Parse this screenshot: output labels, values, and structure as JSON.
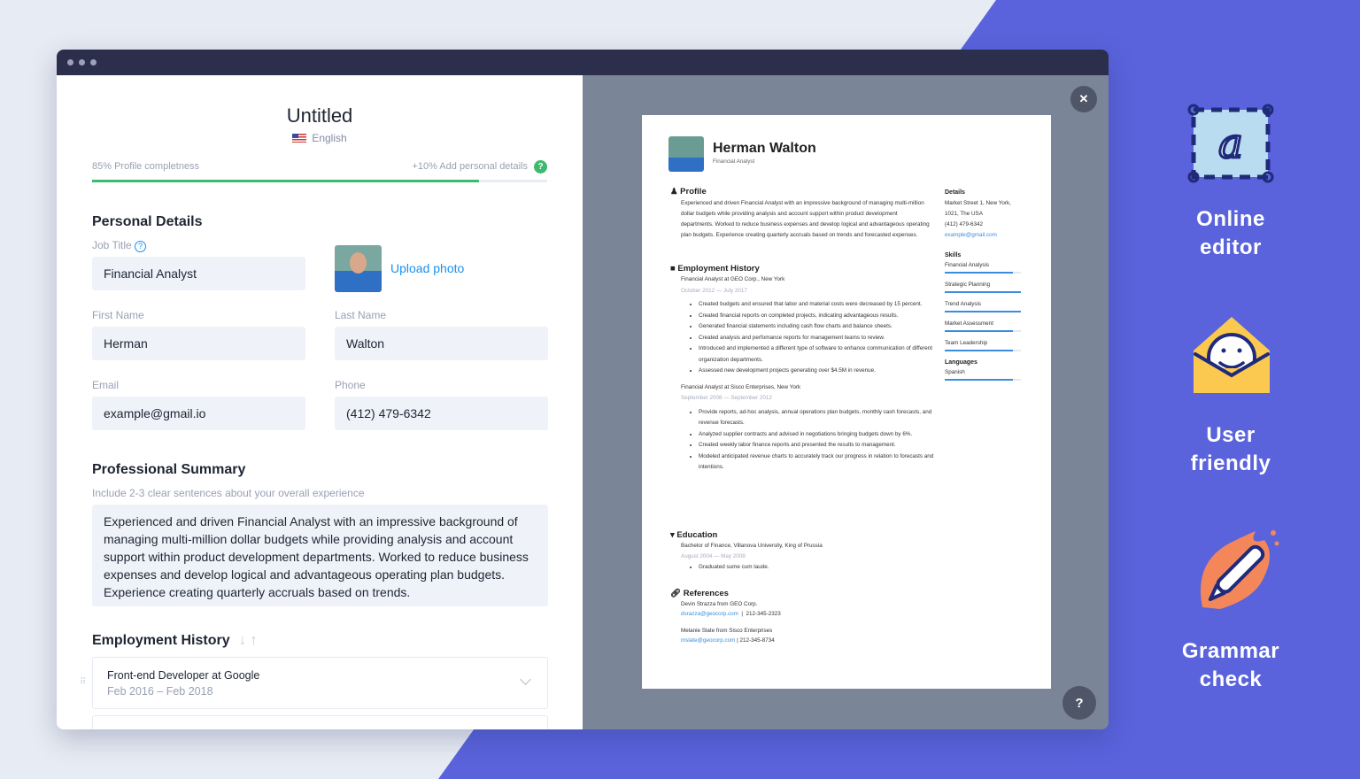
{
  "editor": {
    "title": "Untitled",
    "language": "English",
    "completeness": {
      "label": "85% Profile completness",
      "hint": "+10% Add personal details",
      "percent": 85
    },
    "personal": {
      "heading": "Personal Details",
      "job_title_label": "Job Title",
      "job_title": "Financial Analyst",
      "upload_photo": "Upload photo",
      "first_name_label": "First Name",
      "first_name": "Herman",
      "last_name_label": "Last Name",
      "last_name": "Walton",
      "email_label": "Email",
      "email": "example@gmail.io",
      "phone_label": "Phone",
      "phone": "(412) 479-6342"
    },
    "summary": {
      "heading": "Professional Summary",
      "hint": "Include 2-3 clear sentences about your overall experience",
      "text": "Experienced and driven Financial Analyst with an impressive background of managing multi-million dollar budgets while providing analysis and account support within product development departments. Worked to reduce business expenses and develop logical and advantageous operating plan budgets. Experience creating quarterly accruals based on trends."
    },
    "employment": {
      "heading": "Employment History",
      "items": [
        {
          "title": "Front-end Developer at Google",
          "dates": "Feb 2016 – Feb 2018"
        }
      ]
    }
  },
  "resume": {
    "name": "Herman Walton",
    "title": "Financial Analyst",
    "profile_heading": "Profile",
    "profile": "Experienced and driven Financial Analyst with an impressive background of managing multi-million dollar budgets while providing analysis and account support within product development departments. Worked to reduce business expenses and develop logical and advantageous operating plan budgets. Experience creating quarterly accruals based on trends and forecasted expenses.",
    "employment_heading": "Employment History",
    "jobs": [
      {
        "title": "Financial Analyst at GEO Corp., New York",
        "dates": "October 2012 — July 2017",
        "bullets": [
          "Created budgets and ensured that labor and material costs were decreased by 15 percent.",
          "Created financial reports on completed projects, indicating advantageous results.",
          "Generated financial statements including cash flow charts and balance sheets.",
          "Created analysis and perfomance reports for management teams to review.",
          "Introduced and implemented a different type of software to enhance communication of different organization departments.",
          "Assessed new development projects generating over $4.5M in revenue."
        ]
      },
      {
        "title": "Financial Analyst at Sisco Enterprises, New York",
        "dates": "September 2008 — September 2012",
        "bullets": [
          "Provide reports, ad-hoc analysis, annual operations plan budgets, monthly cash forecasts, and revenue forecasts.",
          "Analyzed supplier contracts and advised in negotiations bringing budgets down by 6%.",
          "Created weekly labor finance reports and presented the results to management.",
          "Modeled anticipated revenue charts to accurately track our progress in relation to forecasts and intentions."
        ]
      }
    ],
    "education_heading": "Education",
    "education": {
      "title": "Bachelor of Finance, Villanova University, King of Prussia",
      "dates": "August 2004 — May 2008",
      "bullets": [
        "Graduated sume cum laude."
      ]
    },
    "references_heading": "References",
    "references": [
      {
        "name": "Devin Strazza from GEO Corp.",
        "email": "dsrazza@geocorp.com",
        "phone": "212-345-2323"
      },
      {
        "name": "Melanie Slate from Sisco Enterprises",
        "email": "mslate@geocorp.com",
        "phone": "212-345-8734"
      }
    ],
    "details_heading": "Details",
    "address1": "Market Street 1, New York,",
    "address2": "1021, The USA",
    "phone": "(412) 479-6342",
    "email": "example@gmail.com",
    "skills_heading": "Skills",
    "skills": [
      {
        "name": "Financial Analysis",
        "level": 0.9
      },
      {
        "name": "Strategic Planning",
        "level": 1
      },
      {
        "name": "Trend Analysis",
        "level": 1
      },
      {
        "name": "Market Assessment",
        "level": 0.9
      },
      {
        "name": "Team Leadership",
        "level": 0.9
      }
    ],
    "languages_heading": "Languages",
    "languages": [
      {
        "name": "Spanish",
        "level": 0.9
      }
    ]
  },
  "features": [
    {
      "label1": "Online",
      "label2": "editor",
      "icon": "editor-icon"
    },
    {
      "label1": "User",
      "label2": "friendly",
      "icon": "smiley-envelope-icon"
    },
    {
      "label1": "Grammar",
      "label2": "check",
      "icon": "pen-icon"
    }
  ],
  "buttons": {
    "close": "✕",
    "help": "?"
  },
  "colors": {
    "accent": "#5a63dc",
    "progress": "#3cba6f",
    "link": "#1a91f0"
  }
}
